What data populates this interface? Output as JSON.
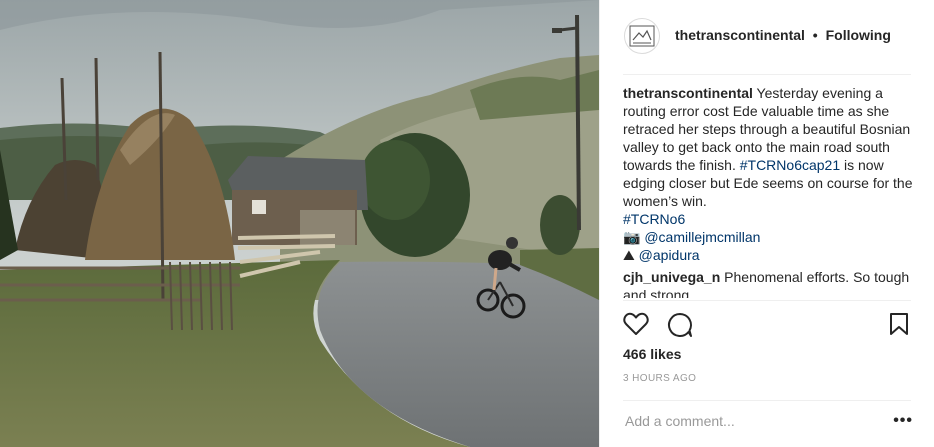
{
  "post": {
    "image_alt": "Cyclist descending a winding mountain road past haystacks and a wooden farmhouse",
    "account": {
      "username": "thetranscontinental",
      "dot": "•",
      "follow_state": "Following"
    },
    "caption": {
      "username": "thetranscontinental",
      "text": "Yesterday evening a routing error cost Ede valuable time as she retraced her steps through a beautiful Bosnian valley to get back onto the main road south towards the finish.",
      "hashtag1": "#TCRNo6cap21",
      "text2": "is now edging closer but Ede seems on course for the women’s win.",
      "hashtag2": "#TCRNo6",
      "camera_emoji": "📷",
      "mention1": "@camillejmcmillan",
      "mountain_emoji": "⛰",
      "mention2": "@apidura"
    },
    "comment": {
      "username": "cjh_univega_n",
      "text": "Phenomenal efforts. So tough and strong"
    },
    "actions": {
      "like": "heart-icon",
      "comment": "comment-icon",
      "save": "bookmark-icon"
    },
    "likes": "466 likes",
    "timestamp": "3 HOURS AGO",
    "add_comment_placeholder": "Add a comment...",
    "more_options": "•••"
  }
}
